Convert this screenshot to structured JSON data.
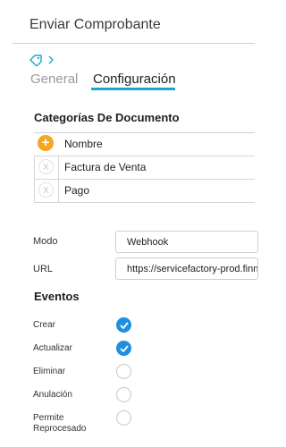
{
  "header": {
    "title": "Enviar Comprobante"
  },
  "breadcrumb": {
    "tag_icon": "tag-icon",
    "chevron_icon": "chevron-right-icon"
  },
  "tabs": [
    {
      "label": "General",
      "active": false
    },
    {
      "label": "Configuración",
      "active": true
    }
  ],
  "categories": {
    "heading": "Categorías De Documento",
    "column_header": "Nombre",
    "rows": [
      {
        "name": "Factura de Venta"
      },
      {
        "name": "Pago"
      }
    ],
    "add_icon": "plus-icon",
    "remove_icon": "close-icon"
  },
  "settings": {
    "mode_label": "Modo",
    "mode_value": "Webhook",
    "url_label": "URL",
    "url_value": "https://servicefactory-prod.finn"
  },
  "events": {
    "heading": "Eventos",
    "items": [
      {
        "label": "Crear",
        "checked": true
      },
      {
        "label": "Actualizar",
        "checked": true
      },
      {
        "label": "Eliminar",
        "checked": false
      },
      {
        "label": "Anulación",
        "checked": false
      },
      {
        "label": "Permite Reprocesado",
        "checked": false
      }
    ]
  },
  "colors": {
    "accent": "#1aa6c9",
    "checked": "#1f8fe0",
    "add_button": "#f5a623"
  }
}
